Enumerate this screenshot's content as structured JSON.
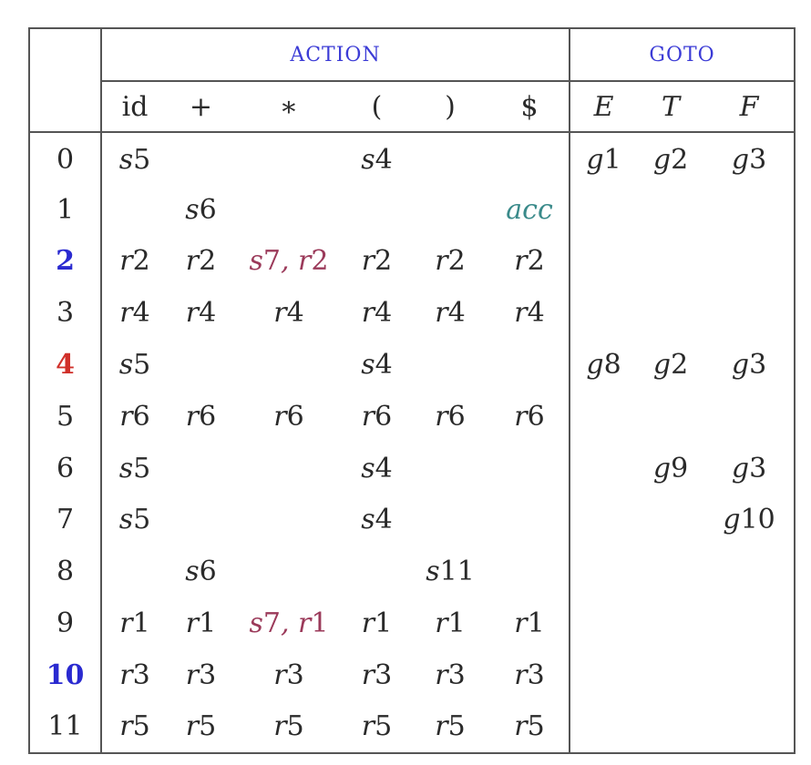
{
  "colors": {
    "action_header": "#3b3bd6",
    "goto_header": "#3b3bd6",
    "conflict": "#9b3a5a",
    "accept": "#3a8a8a",
    "state_blue": "#2a2ad0",
    "state_red": "#d0302a",
    "text": "#2a2a2a"
  },
  "table": {
    "group_headers": {
      "action": "ACTION",
      "goto": "GOTO"
    },
    "action_symbols": [
      "id",
      "+",
      "∗",
      "(",
      ")",
      "$"
    ],
    "goto_symbols": [
      "E",
      "T",
      "F"
    ],
    "rows": [
      {
        "state": "0",
        "state_color": "default",
        "action": [
          "s5",
          "",
          "",
          "s4",
          "",
          ""
        ],
        "goto": [
          "g1",
          "g2",
          "g3"
        ]
      },
      {
        "state": "1",
        "state_color": "default",
        "action": [
          "",
          "s6",
          "",
          "",
          "",
          "acc"
        ],
        "goto": [
          "",
          "",
          ""
        ]
      },
      {
        "state": "2",
        "state_color": "blue",
        "action": [
          "r2",
          "r2",
          "s7, r2",
          "r2",
          "r2",
          "r2"
        ],
        "goto": [
          "",
          "",
          ""
        ]
      },
      {
        "state": "3",
        "state_color": "default",
        "action": [
          "r4",
          "r4",
          "r4",
          "r4",
          "r4",
          "r4"
        ],
        "goto": [
          "",
          "",
          ""
        ]
      },
      {
        "state": "4",
        "state_color": "red",
        "action": [
          "s5",
          "",
          "",
          "s4",
          "",
          ""
        ],
        "goto": [
          "g8",
          "g2",
          "g3"
        ]
      },
      {
        "state": "5",
        "state_color": "default",
        "action": [
          "r6",
          "r6",
          "r6",
          "r6",
          "r6",
          "r6"
        ],
        "goto": [
          "",
          "",
          ""
        ]
      },
      {
        "state": "6",
        "state_color": "default",
        "action": [
          "s5",
          "",
          "",
          "s4",
          "",
          ""
        ],
        "goto": [
          "",
          "g9",
          "g3"
        ]
      },
      {
        "state": "7",
        "state_color": "default",
        "action": [
          "s5",
          "",
          "",
          "s4",
          "",
          ""
        ],
        "goto": [
          "",
          "",
          "g10"
        ]
      },
      {
        "state": "8",
        "state_color": "default",
        "action": [
          "",
          "s6",
          "",
          "",
          "s11",
          ""
        ],
        "goto": [
          "",
          "",
          ""
        ]
      },
      {
        "state": "9",
        "state_color": "default",
        "action": [
          "r1",
          "r1",
          "s7, r1",
          "r1",
          "r1",
          "r1"
        ],
        "goto": [
          "",
          "",
          ""
        ]
      },
      {
        "state": "10",
        "state_color": "blue",
        "action": [
          "r3",
          "r3",
          "r3",
          "r3",
          "r3",
          "r3"
        ],
        "goto": [
          "",
          "",
          ""
        ]
      },
      {
        "state": "11",
        "state_color": "default",
        "action": [
          "r5",
          "r5",
          "r5",
          "r5",
          "r5",
          "r5"
        ],
        "goto": [
          "",
          "",
          ""
        ]
      }
    ]
  }
}
